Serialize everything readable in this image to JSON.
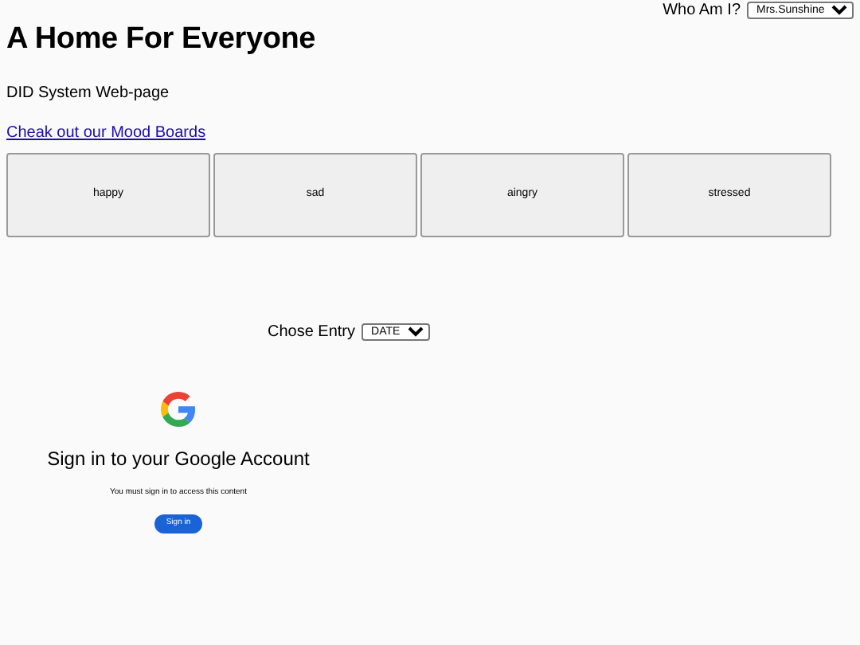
{
  "who_am_i": {
    "label": "Who Am I?",
    "value": "Mrs.Sunshine"
  },
  "title": "A Home For Everyone",
  "subtitle": "DID System Web-page",
  "mood_link": "Cheak out our Mood Boards",
  "moods": [
    "happy",
    "sad",
    "aingry",
    "stressed"
  ],
  "entry": {
    "label": "Chose Entry",
    "value": "DATE"
  },
  "google_signin": {
    "title": "Sign in to your Google Account",
    "message": "You must sign in to access this content",
    "button": "Sign in"
  }
}
